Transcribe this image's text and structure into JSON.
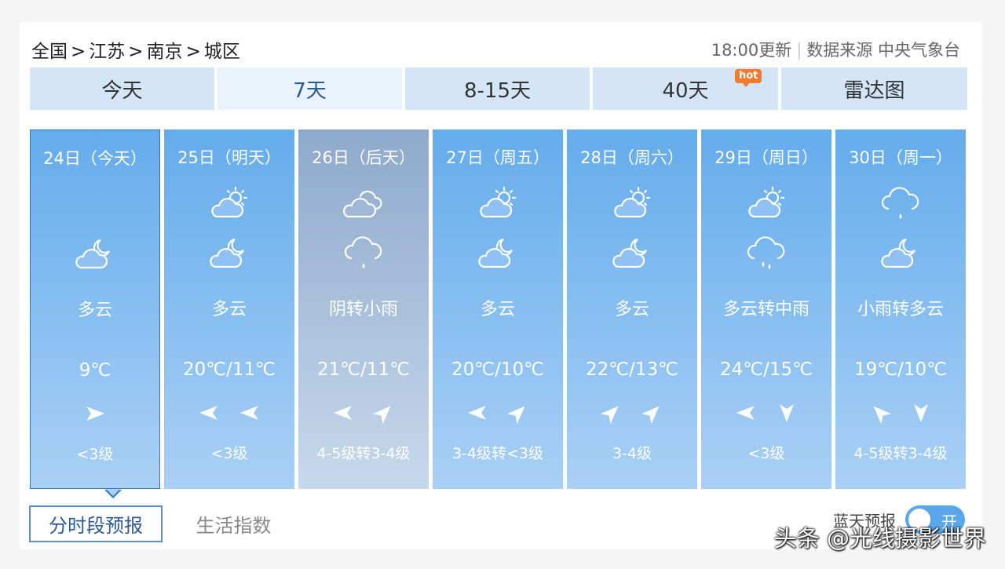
{
  "breadcrumb": {
    "items": [
      "全国",
      "江苏",
      "南京",
      "城区"
    ],
    "separator": ">"
  },
  "update": {
    "time": "18:00更新",
    "divider": "|",
    "source": "数据来源 中央气象台"
  },
  "tabs": [
    {
      "label": "今天"
    },
    {
      "label": "7天"
    },
    {
      "label": "8-15天"
    },
    {
      "label": "40天",
      "badge": "hot"
    },
    {
      "label": "雷达图"
    }
  ],
  "days": [
    {
      "date": "24日（今天）",
      "icon_day": "",
      "icon_night": "partly-cloudy-night-icon",
      "desc": "多云",
      "temp": "9℃",
      "wind_dirs": [
        "east"
      ],
      "wind_level": "<3级"
    },
    {
      "date": "25日（明天）",
      "icon_day": "partly-cloudy-day-icon",
      "icon_night": "partly-cloudy-night-icon",
      "desc": "多云",
      "temp": "20℃/11℃",
      "wind_dirs": [
        "west",
        "west"
      ],
      "wind_level": "<3级"
    },
    {
      "date": "26日（后天）",
      "icon_day": "overcast-icon",
      "icon_night": "light-rain-icon",
      "desc": "阴转小雨",
      "temp": "21℃/11℃",
      "wind_dirs": [
        "west",
        "northeast"
      ],
      "wind_level": "4-5级转3-4级"
    },
    {
      "date": "27日（周五）",
      "icon_day": "partly-cloudy-day-icon",
      "icon_night": "partly-cloudy-night-icon",
      "desc": "多云",
      "temp": "20℃/10℃",
      "wind_dirs": [
        "west",
        "northeast"
      ],
      "wind_level": "3-4级转<3级"
    },
    {
      "date": "28日（周六）",
      "icon_day": "partly-cloudy-day-icon",
      "icon_night": "partly-cloudy-night-icon",
      "desc": "多云",
      "temp": "22℃/13℃",
      "wind_dirs": [
        "northeast",
        "northeast"
      ],
      "wind_level": "3-4级"
    },
    {
      "date": "29日（周日）",
      "icon_day": "partly-cloudy-day-icon",
      "icon_night": "moderate-rain-icon",
      "desc": "多云转中雨",
      "temp": "24℃/15℃",
      "wind_dirs": [
        "west",
        "south"
      ],
      "wind_level": "<3级"
    },
    {
      "date": "30日（周一）",
      "icon_day": "light-rain-icon",
      "icon_night": "partly-cloudy-night-icon",
      "desc": "小雨转多云",
      "temp": "19℃/10℃",
      "wind_dirs": [
        "northwest",
        "south"
      ],
      "wind_level": "4-5级转3-4级"
    }
  ],
  "subtabs": {
    "active": "分时段预报",
    "inactive": "生活指数"
  },
  "bluesky": {
    "label": "蓝天预报",
    "toggle": "开"
  },
  "watermark": "头条 @光线摄影世界"
}
